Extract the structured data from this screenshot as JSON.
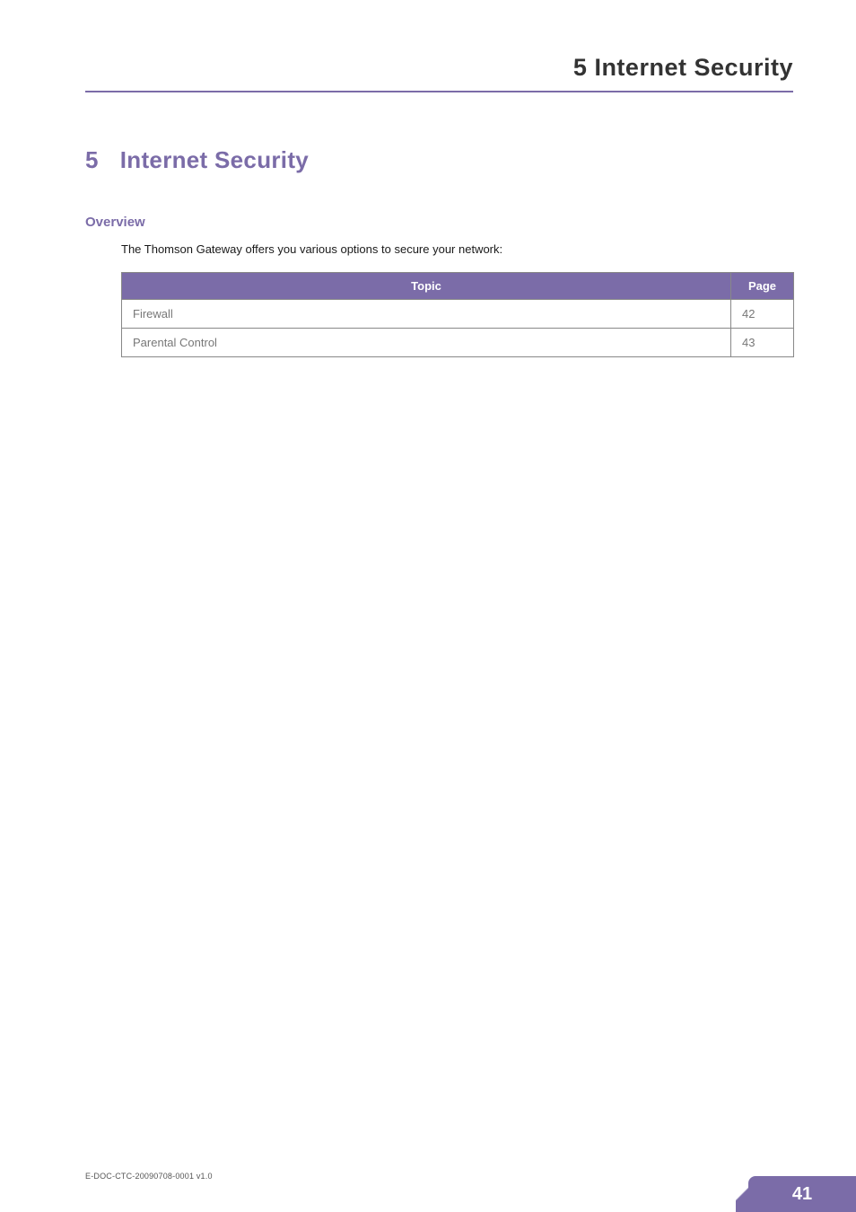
{
  "running_header": {
    "number": "5",
    "title": "Internet Security"
  },
  "chapter": {
    "number": "5",
    "title": "Internet Security"
  },
  "overview": {
    "heading": "Overview",
    "text": "The Thomson Gateway offers you various options to secure your network:"
  },
  "table": {
    "headers": {
      "topic": "Topic",
      "page": "Page"
    },
    "rows": [
      {
        "topic": "Firewall",
        "page": "42"
      },
      {
        "topic": "Parental Control",
        "page": "43"
      }
    ]
  },
  "footer": {
    "doc_id": "E-DOC-CTC-20090708-0001 v1.0",
    "page_number": "41"
  }
}
